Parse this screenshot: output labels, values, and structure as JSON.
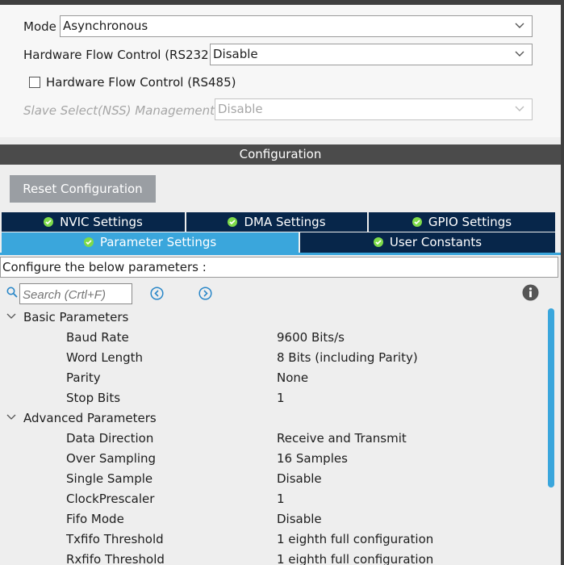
{
  "mode_section": {
    "mode_label": "Mode",
    "mode_value": "Asynchronous",
    "hw_flow_rs232_label": "Hardware Flow Control (RS232)",
    "hw_flow_rs232_value": "Disable",
    "hw_flow_rs485_label": "Hardware Flow Control (RS485)",
    "hw_flow_rs485_checked": false,
    "nss_label": "Slave Select(NSS) Management",
    "nss_value": "Disable"
  },
  "configuration": {
    "header": "Configuration",
    "reset_label": "Reset Configuration",
    "tabs_row1": [
      {
        "label": "NVIC Settings",
        "icon": "check-circle-icon"
      },
      {
        "label": "DMA Settings",
        "icon": "check-circle-icon"
      },
      {
        "label": "GPIO Settings",
        "icon": "check-circle-icon"
      }
    ],
    "tabs_row2": [
      {
        "label": "Parameter Settings",
        "icon": "check-circle-icon",
        "active": true
      },
      {
        "label": "User Constants",
        "icon": "check-circle-icon",
        "active": false
      }
    ],
    "description": "Configure the below parameters :",
    "search_placeholder": "Search (Crtl+F)",
    "icons": {
      "search": "search-icon",
      "prev": "chevron-left-circle-icon",
      "next": "chevron-right-circle-icon",
      "info": "info-icon"
    },
    "colors": {
      "accent": "#3aa6dc",
      "tab_dark": "#07264a",
      "check_green": "#7edb4a",
      "header_bg": "#4b4b4b"
    }
  },
  "parameters": {
    "groups": [
      {
        "label": "Basic Parameters",
        "expanded": true,
        "items": [
          {
            "name": "Baud Rate",
            "value": "9600 Bits/s"
          },
          {
            "name": "Word Length",
            "value": "8 Bits (including Parity)"
          },
          {
            "name": "Parity",
            "value": "None"
          },
          {
            "name": "Stop Bits",
            "value": "1"
          }
        ]
      },
      {
        "label": "Advanced Parameters",
        "expanded": true,
        "items": [
          {
            "name": "Data Direction",
            "value": "Receive and Transmit"
          },
          {
            "name": "Over Sampling",
            "value": "16 Samples"
          },
          {
            "name": "Single Sample",
            "value": "Disable"
          },
          {
            "name": "ClockPrescaler",
            "value": "1"
          },
          {
            "name": "Fifo Mode",
            "value": "Disable"
          },
          {
            "name": "Txfifo Threshold",
            "value": "1 eighth full configuration"
          },
          {
            "name": "Rxfifo Threshold",
            "value": "1 eighth full configuration"
          }
        ]
      }
    ]
  }
}
